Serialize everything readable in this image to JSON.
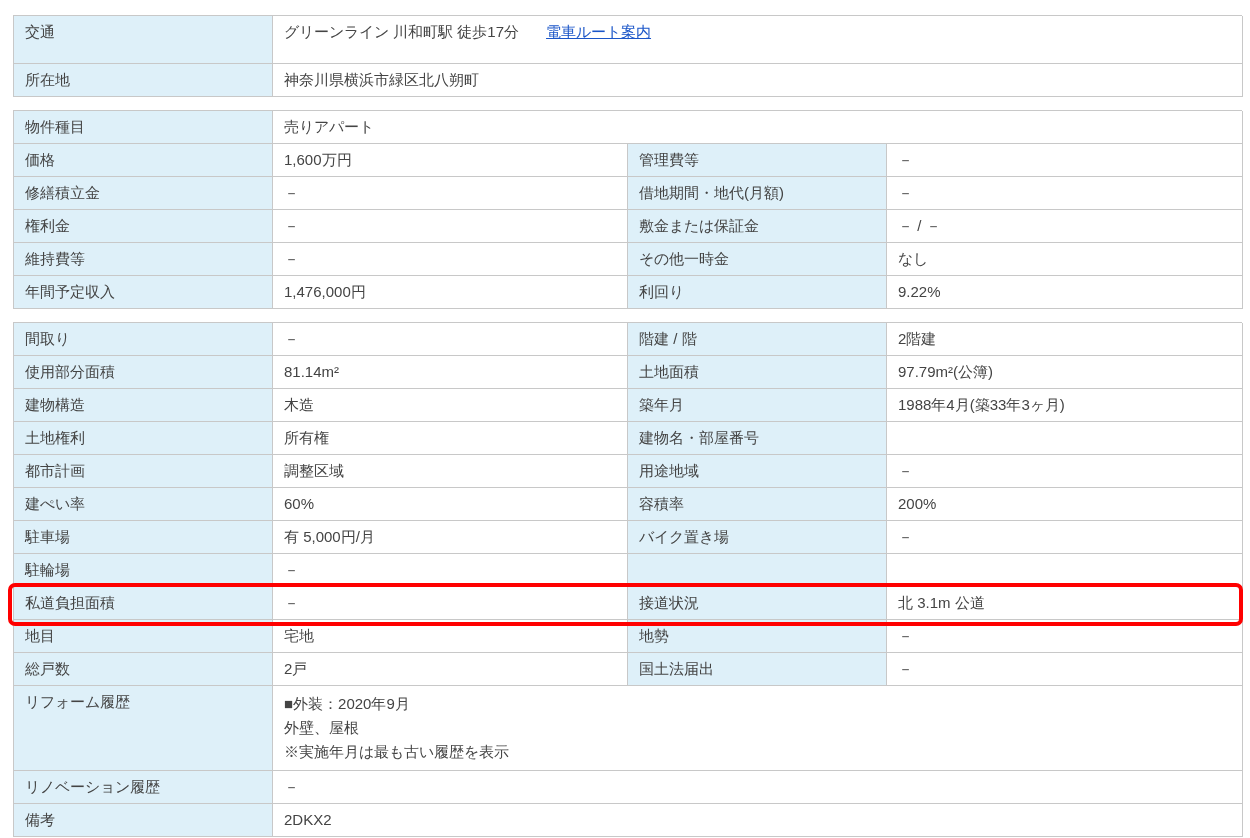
{
  "sections": [
    {
      "rows": [
        {
          "pairs": [
            {
              "label": "交通",
              "value": "グリーンライン 川和町駅 徒歩17分",
              "link": "電車ルート案内"
            }
          ]
        },
        {
          "pairs": [
            {
              "label": "所在地",
              "value": "神奈川県横浜市緑区北八朔町"
            }
          ]
        }
      ]
    },
    {
      "rows": [
        {
          "pairs": [
            {
              "label": "物件種目",
              "value": "売りアパート"
            }
          ]
        },
        {
          "pairs": [
            {
              "label": "価格",
              "value": "1,600万円"
            },
            {
              "label": "管理費等",
              "value": "－"
            }
          ]
        },
        {
          "pairs": [
            {
              "label": "修繕積立金",
              "value": "－"
            },
            {
              "label": "借地期間・地代(月額)",
              "value": "－"
            }
          ]
        },
        {
          "pairs": [
            {
              "label": "権利金",
              "value": "－"
            },
            {
              "label": "敷金または保証金",
              "value": "－ / －"
            }
          ]
        },
        {
          "pairs": [
            {
              "label": "維持費等",
              "value": "－"
            },
            {
              "label": "その他一時金",
              "value": "なし"
            }
          ]
        },
        {
          "pairs": [
            {
              "label": "年間予定収入",
              "value": "1,476,000円"
            },
            {
              "label": "利回り",
              "value": "9.22%"
            }
          ]
        }
      ]
    },
    {
      "rows": [
        {
          "pairs": [
            {
              "label": "間取り",
              "value": "－"
            },
            {
              "label": "階建 / 階",
              "value": "2階建"
            }
          ]
        },
        {
          "pairs": [
            {
              "label": "使用部分面積",
              "value": "81.14m²"
            },
            {
              "label": "土地面積",
              "value": "97.79m²(公簿)"
            }
          ]
        },
        {
          "pairs": [
            {
              "label": "建物構造",
              "value": "木造"
            },
            {
              "label": "築年月",
              "value": "1988年4月(築33年3ヶ月)"
            }
          ]
        },
        {
          "pairs": [
            {
              "label": "土地権利",
              "value": "所有権"
            },
            {
              "label": "建物名・部屋番号"
            }
          ]
        },
        {
          "pairs": [
            {
              "label": "都市計画",
              "value": "調整区域"
            },
            {
              "label": "用途地域",
              "value": "－"
            }
          ]
        },
        {
          "pairs": [
            {
              "label": "建ぺい率",
              "value": "60%"
            },
            {
              "label": "容積率",
              "value": "200%"
            }
          ]
        },
        {
          "pairs": [
            {
              "label": "駐車場",
              "value": "有 5,000円/月"
            },
            {
              "label": "バイク置き場",
              "value": "－"
            }
          ]
        },
        {
          "kind": "half",
          "pairs": [
            {
              "label": "駐輪場",
              "value": "－"
            }
          ]
        },
        {
          "highlighted": true,
          "pairs": [
            {
              "label": "私道負担面積",
              "value": "－"
            },
            {
              "label": "接道状況",
              "value": "北 3.1m 公道"
            }
          ]
        },
        {
          "pairs": [
            {
              "label": "地目",
              "value": "宅地"
            },
            {
              "label": "地勢",
              "value": "－"
            }
          ]
        },
        {
          "pairs": [
            {
              "label": "総戸数",
              "value": "2戸"
            },
            {
              "label": "国土法届出",
              "value": "－"
            }
          ]
        },
        {
          "pairs": [
            {
              "label": "リフォーム履歴",
              "lines": [
                "■外装：2020年9月",
                "外壁、屋根",
                "※実施年月は最も古い履歴を表示"
              ]
            }
          ]
        },
        {
          "pairs": [
            {
              "label": "リノベーション履歴",
              "value": "－"
            }
          ]
        },
        {
          "pairs": [
            {
              "label": "備考",
              "value": "2DKX2"
            }
          ]
        }
      ]
    }
  ]
}
